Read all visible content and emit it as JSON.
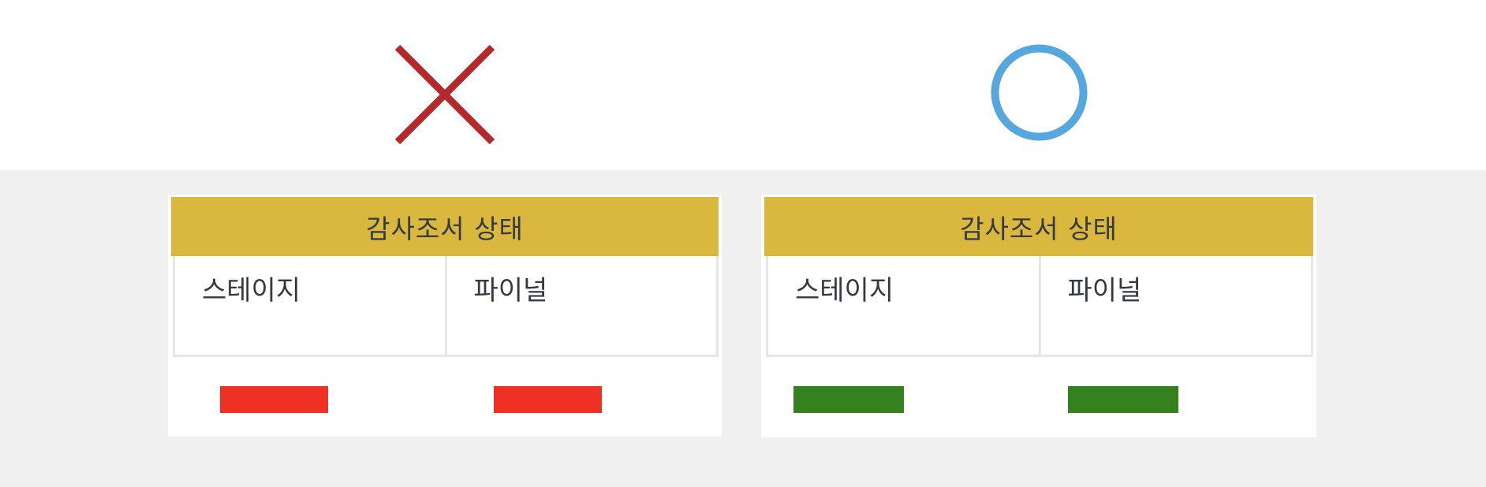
{
  "comparison": {
    "incorrect": {
      "symbol_icon": "cross-icon",
      "symbol_color": "#b5292c",
      "panel": {
        "title": "감사조서 상태",
        "cells": [
          {
            "label": "스테이지",
            "indicator_color": "#ee3124"
          },
          {
            "label": "파이널",
            "indicator_color": "#ee3124"
          }
        ]
      }
    },
    "correct": {
      "symbol_icon": "circle-icon",
      "symbol_color": "#55a7dd",
      "panel": {
        "title": "감사조서 상태",
        "cells": [
          {
            "label": "스테이지",
            "indicator_color": "#358120"
          },
          {
            "label": "파이널",
            "indicator_color": "#358120"
          }
        ]
      }
    }
  },
  "colors": {
    "header_background": "#dab73d",
    "text": "#333a44",
    "page_background_bottom": "#f0f0f0"
  }
}
